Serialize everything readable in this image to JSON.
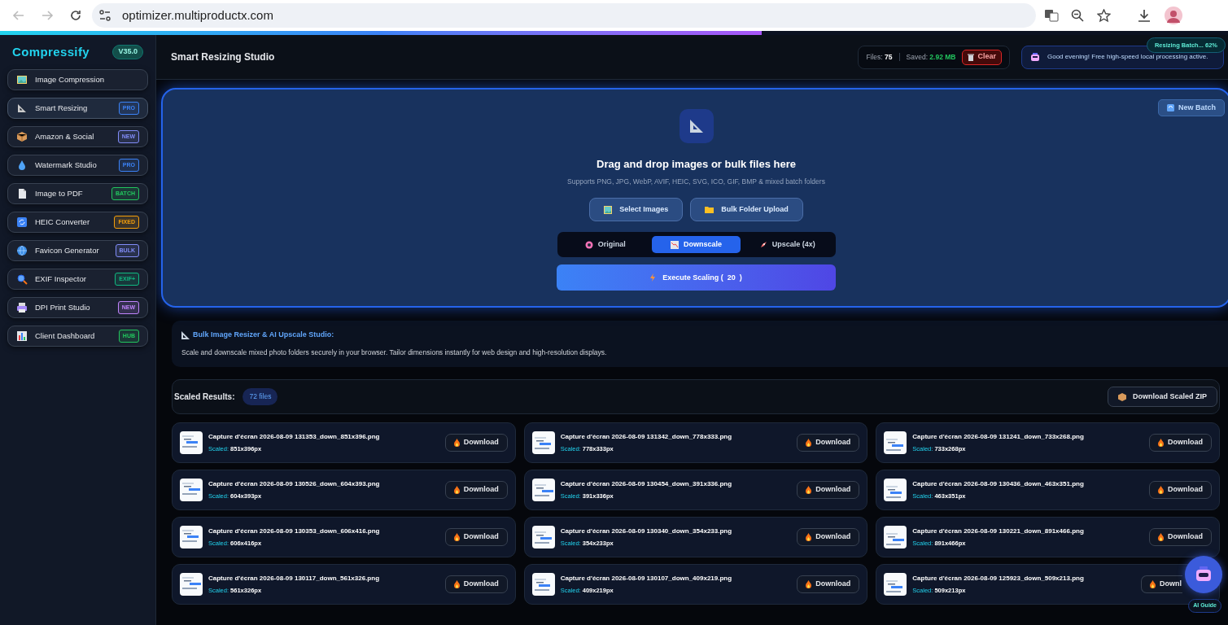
{
  "browser": {
    "url": "optimizer.multiproductx.com"
  },
  "progress": {
    "level": 0.62,
    "label": "Resizing Batch... 62%"
  },
  "sidebar": {
    "brand": "Compressify",
    "version": "V35.0",
    "items": [
      {
        "label": "Image Compression",
        "selected": false
      },
      {
        "label": "Smart Resizing",
        "badge": "PRO",
        "color": "#3b82f6",
        "selected": true
      },
      {
        "label": "Amazon & Social",
        "badge": "NEW",
        "color": "#818cf8",
        "selected": false
      },
      {
        "label": "Watermark Studio",
        "badge": "PRO",
        "color": "#3b82f6",
        "selected": false
      },
      {
        "label": "Image to PDF",
        "badge": "BATCH",
        "color": "#22c55e",
        "selected": false
      },
      {
        "label": "HEIC Converter",
        "badge": "FIXED",
        "color": "#f59e0b",
        "selected": false
      },
      {
        "label": "Favicon Generator",
        "badge": "BULK",
        "color": "#818cf8",
        "selected": false
      },
      {
        "label": "EXIF Inspector",
        "badge": "EXIF+",
        "color": "#10b981",
        "selected": false
      },
      {
        "label": "DPI Print Studio",
        "badge": "NEW",
        "color": "#c084fc",
        "selected": false
      },
      {
        "label": "Client Dashboard",
        "badge": "HUB",
        "color": "#22c55e",
        "selected": false
      }
    ]
  },
  "header": {
    "title": "Smart Resizing Studio",
    "files_label": "Files:",
    "files": "75",
    "saved_label": "Saved:",
    "saved": "2.92 MB",
    "clear": "Clear",
    "greeting": "Good evening! Free high-speed local processing active."
  },
  "dropzone": {
    "new_batch": "New Batch",
    "title": "Drag and drop images or bulk files here",
    "subtitle": "Supports PNG, JPG, WebP, AVIF, HEIC, SVG, ICO, GIF, BMP & mixed batch folders",
    "buttons": [
      "Select Images",
      "Bulk Folder Upload"
    ],
    "modes": [
      {
        "label": "Original",
        "selected": false
      },
      {
        "label": "Downscale",
        "selected": true
      },
      {
        "label": "Upscale (4x)",
        "selected": false
      }
    ],
    "execute": "Execute Scaling (  20  )"
  },
  "info": {
    "title": "Bulk Image Resizer & AI Upscale Studio:",
    "text": "Scale and downscale mixed photo folders securely in your browser. Tailor dimensions instantly for web design and high-resolution displays."
  },
  "results": {
    "title": "Scaled Results:",
    "count": "72 files",
    "zip": "Download Scaled ZIP",
    "files": [
      {
        "name": "Capture d'écran 2026-08-09 131353_down_851x396.png",
        "scaled_label": "Scaled:",
        "size": "851x396px",
        "download": "Download",
        "covered": false
      },
      {
        "name": "Capture d'écran 2026-08-09 131342_down_778x333.png",
        "scaled_label": "Scaled:",
        "size": "778x333px",
        "download": "Download",
        "covered": false
      },
      {
        "name": "Capture d'écran 2026-08-09 131241_down_733x268.png",
        "scaled_label": "Scaled:",
        "size": "733x268px",
        "download": "Download",
        "covered": false
      },
      {
        "name": "Capture d'écran 2026-08-09 130526_down_604x393.png",
        "scaled_label": "Scaled:",
        "size": "604x393px",
        "download": "Download",
        "covered": false
      },
      {
        "name": "Capture d'écran 2026-08-09 130454_down_391x336.png",
        "scaled_label": "Scaled:",
        "size": "391x336px",
        "download": "Download",
        "covered": false
      },
      {
        "name": "Capture d'écran 2026-08-09 130436_down_463x351.png",
        "scaled_label": "Scaled:",
        "size": "463x351px",
        "download": "Download",
        "covered": false
      },
      {
        "name": "Capture d'écran 2026-08-09 130353_down_606x416.png",
        "scaled_label": "Scaled:",
        "size": "606x416px",
        "download": "Download",
        "covered": false
      },
      {
        "name": "Capture d'écran 2026-08-09 130340_down_354x233.png",
        "scaled_label": "Scaled:",
        "size": "354x233px",
        "download": "Download",
        "covered": false
      },
      {
        "name": "Capture d'écran 2026-08-09 130221_down_891x466.png",
        "scaled_label": "Scaled:",
        "size": "891x466px",
        "download": "Download",
        "covered": false
      },
      {
        "name": "Capture d'écran 2026-08-09 130117_down_561x326.png",
        "scaled_label": "Scaled:",
        "size": "561x326px",
        "download": "Download",
        "covered": false
      },
      {
        "name": "Capture d'écran 2026-08-09 130107_down_409x219.png",
        "scaled_label": "Scaled:",
        "size": "409x219px",
        "download": "Download",
        "covered": false
      },
      {
        "name": "Capture d'écran 2026-08-09 125923_down_509x213.png",
        "scaled_label": "Scaled:",
        "size": "509x213px",
        "download": "Downl",
        "covered": true
      }
    ]
  },
  "assistant": {
    "label": "AI Guide"
  }
}
